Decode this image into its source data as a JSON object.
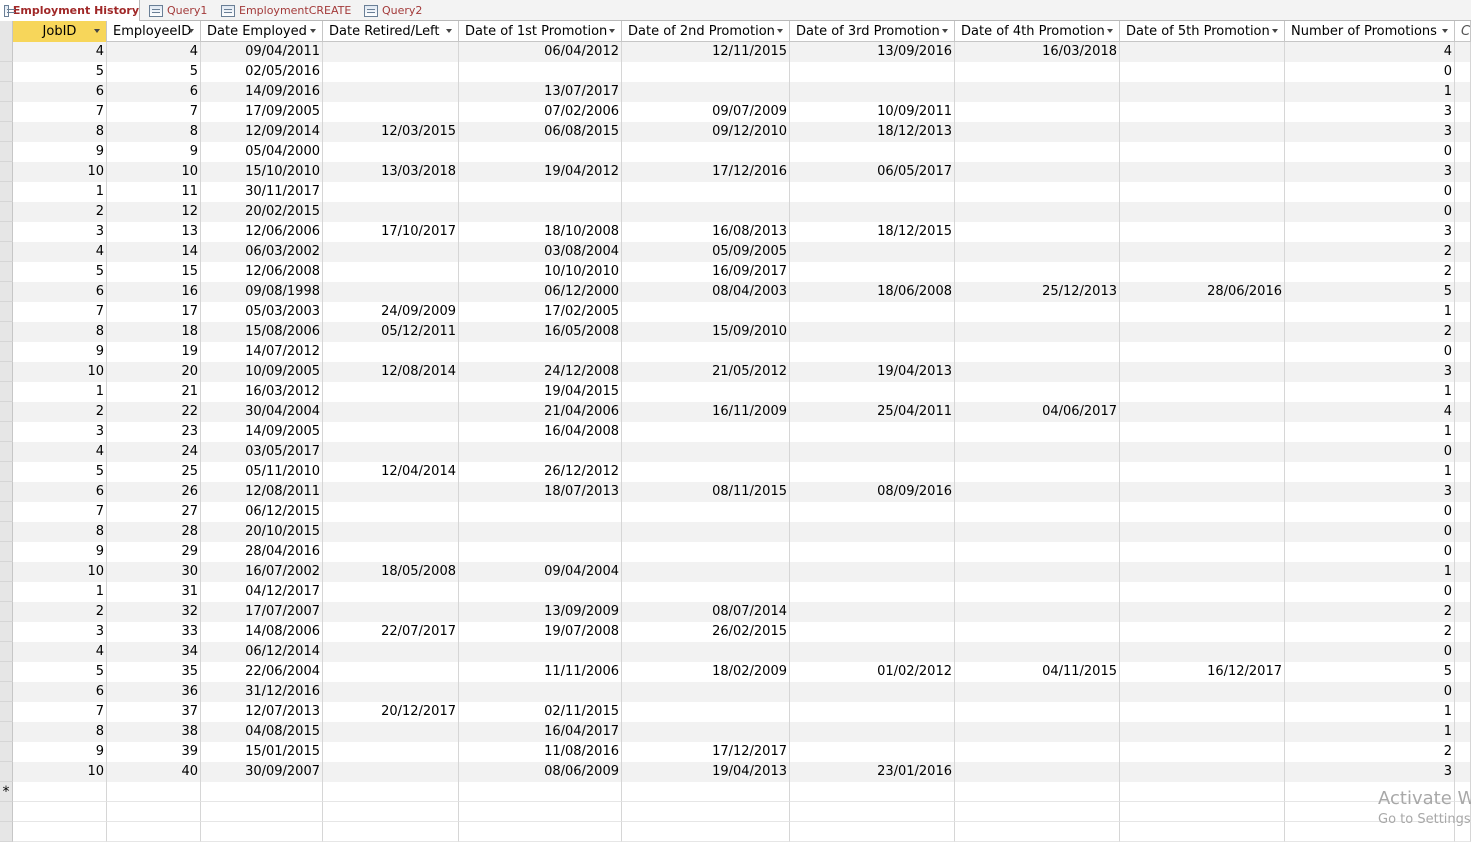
{
  "tabs": [
    {
      "label": "Employment History",
      "icon": "table-icon",
      "active": true
    },
    {
      "label": "Query1",
      "icon": "query-icon",
      "active": false
    },
    {
      "label": "EmploymentCREATE",
      "icon": "query-icon",
      "active": false
    },
    {
      "label": "Query2",
      "icon": "query-icon",
      "active": false
    }
  ],
  "columns": [
    "JobID",
    "EmployeeID",
    "Date Employed",
    "Date Retired/Left",
    "Date of 1st Promotion",
    "Date of 2nd Promotion",
    "Date of 3rd Promotion",
    "Date of 4th Promotion",
    "Date of 5th Promotion",
    "Number of Promotions",
    "Cl"
  ],
  "rows": [
    [
      "4",
      "4",
      "09/04/2011",
      "",
      "06/04/2012",
      "12/11/2015",
      "13/09/2016",
      "16/03/2018",
      "",
      "4"
    ],
    [
      "5",
      "5",
      "02/05/2016",
      "",
      "",
      "",
      "",
      "",
      "",
      "0"
    ],
    [
      "6",
      "6",
      "14/09/2016",
      "",
      "13/07/2017",
      "",
      "",
      "",
      "",
      "1"
    ],
    [
      "7",
      "7",
      "17/09/2005",
      "",
      "07/02/2006",
      "09/07/2009",
      "10/09/2011",
      "",
      "",
      "3"
    ],
    [
      "8",
      "8",
      "12/09/2014",
      "12/03/2015",
      "06/08/2015",
      "09/12/2010",
      "18/12/2013",
      "",
      "",
      "3"
    ],
    [
      "9",
      "9",
      "05/04/2000",
      "",
      "",
      "",
      "",
      "",
      "",
      "0"
    ],
    [
      "10",
      "10",
      "15/10/2010",
      "13/03/2018",
      "19/04/2012",
      "17/12/2016",
      "06/05/2017",
      "",
      "",
      "3"
    ],
    [
      "1",
      "11",
      "30/11/2017",
      "",
      "",
      "",
      "",
      "",
      "",
      "0"
    ],
    [
      "2",
      "12",
      "20/02/2015",
      "",
      "",
      "",
      "",
      "",
      "",
      "0"
    ],
    [
      "3",
      "13",
      "12/06/2006",
      "17/10/2017",
      "18/10/2008",
      "16/08/2013",
      "18/12/2015",
      "",
      "",
      "3"
    ],
    [
      "4",
      "14",
      "06/03/2002",
      "",
      "03/08/2004",
      "05/09/2005",
      "",
      "",
      "",
      "2"
    ],
    [
      "5",
      "15",
      "12/06/2008",
      "",
      "10/10/2010",
      "16/09/2017",
      "",
      "",
      "",
      "2"
    ],
    [
      "6",
      "16",
      "09/08/1998",
      "",
      "06/12/2000",
      "08/04/2003",
      "18/06/2008",
      "25/12/2013",
      "28/06/2016",
      "5"
    ],
    [
      "7",
      "17",
      "05/03/2003",
      "24/09/2009",
      "17/02/2005",
      "",
      "",
      "",
      "",
      "1"
    ],
    [
      "8",
      "18",
      "15/08/2006",
      "05/12/2011",
      "16/05/2008",
      "15/09/2010",
      "",
      "",
      "",
      "2"
    ],
    [
      "9",
      "19",
      "14/07/2012",
      "",
      "",
      "",
      "",
      "",
      "",
      "0"
    ],
    [
      "10",
      "20",
      "10/09/2005",
      "12/08/2014",
      "24/12/2008",
      "21/05/2012",
      "19/04/2013",
      "",
      "",
      "3"
    ],
    [
      "1",
      "21",
      "16/03/2012",
      "",
      "19/04/2015",
      "",
      "",
      "",
      "",
      "1"
    ],
    [
      "2",
      "22",
      "30/04/2004",
      "",
      "21/04/2006",
      "16/11/2009",
      "25/04/2011",
      "04/06/2017",
      "",
      "4"
    ],
    [
      "3",
      "23",
      "14/09/2005",
      "",
      "16/04/2008",
      "",
      "",
      "",
      "",
      "1"
    ],
    [
      "4",
      "24",
      "03/05/2017",
      "",
      "",
      "",
      "",
      "",
      "",
      "0"
    ],
    [
      "5",
      "25",
      "05/11/2010",
      "12/04/2014",
      "26/12/2012",
      "",
      "",
      "",
      "",
      "1"
    ],
    [
      "6",
      "26",
      "12/08/2011",
      "",
      "18/07/2013",
      "08/11/2015",
      "08/09/2016",
      "",
      "",
      "3"
    ],
    [
      "7",
      "27",
      "06/12/2015",
      "",
      "",
      "",
      "",
      "",
      "",
      "0"
    ],
    [
      "8",
      "28",
      "20/10/2015",
      "",
      "",
      "",
      "",
      "",
      "",
      "0"
    ],
    [
      "9",
      "29",
      "28/04/2016",
      "",
      "",
      "",
      "",
      "",
      "",
      "0"
    ],
    [
      "10",
      "30",
      "16/07/2002",
      "18/05/2008",
      "09/04/2004",
      "",
      "",
      "",
      "",
      "1"
    ],
    [
      "1",
      "31",
      "04/12/2017",
      "",
      "",
      "",
      "",
      "",
      "",
      "0"
    ],
    [
      "2",
      "32",
      "17/07/2007",
      "",
      "13/09/2009",
      "08/07/2014",
      "",
      "",
      "",
      "2"
    ],
    [
      "3",
      "33",
      "14/08/2006",
      "22/07/2017",
      "19/07/2008",
      "26/02/2015",
      "",
      "",
      "",
      "2"
    ],
    [
      "4",
      "34",
      "06/12/2014",
      "",
      "",
      "",
      "",
      "",
      "",
      "0"
    ],
    [
      "5",
      "35",
      "22/06/2004",
      "",
      "11/11/2006",
      "18/02/2009",
      "01/02/2012",
      "04/11/2015",
      "16/12/2017",
      "5"
    ],
    [
      "6",
      "36",
      "31/12/2016",
      "",
      "",
      "",
      "",
      "",
      "",
      "0"
    ],
    [
      "7",
      "37",
      "12/07/2013",
      "20/12/2017",
      "02/11/2015",
      "",
      "",
      "",
      "",
      "1"
    ],
    [
      "8",
      "38",
      "04/08/2015",
      "",
      "16/04/2017",
      "",
      "",
      "",
      "",
      "1"
    ],
    [
      "9",
      "39",
      "15/01/2015",
      "",
      "11/08/2016",
      "17/12/2017",
      "",
      "",
      "",
      "2"
    ],
    [
      "10",
      "40",
      "30/09/2007",
      "",
      "08/06/2009",
      "19/04/2013",
      "23/01/2016",
      "",
      "",
      "3"
    ]
  ],
  "new_record_marker": "*",
  "watermark": {
    "line1": "Activate W",
    "line2": "Go to Settings"
  },
  "colors": {
    "selected_header": "#f7d65a",
    "alt_row": "#f2f2f2",
    "tab_text": "#a02828"
  }
}
